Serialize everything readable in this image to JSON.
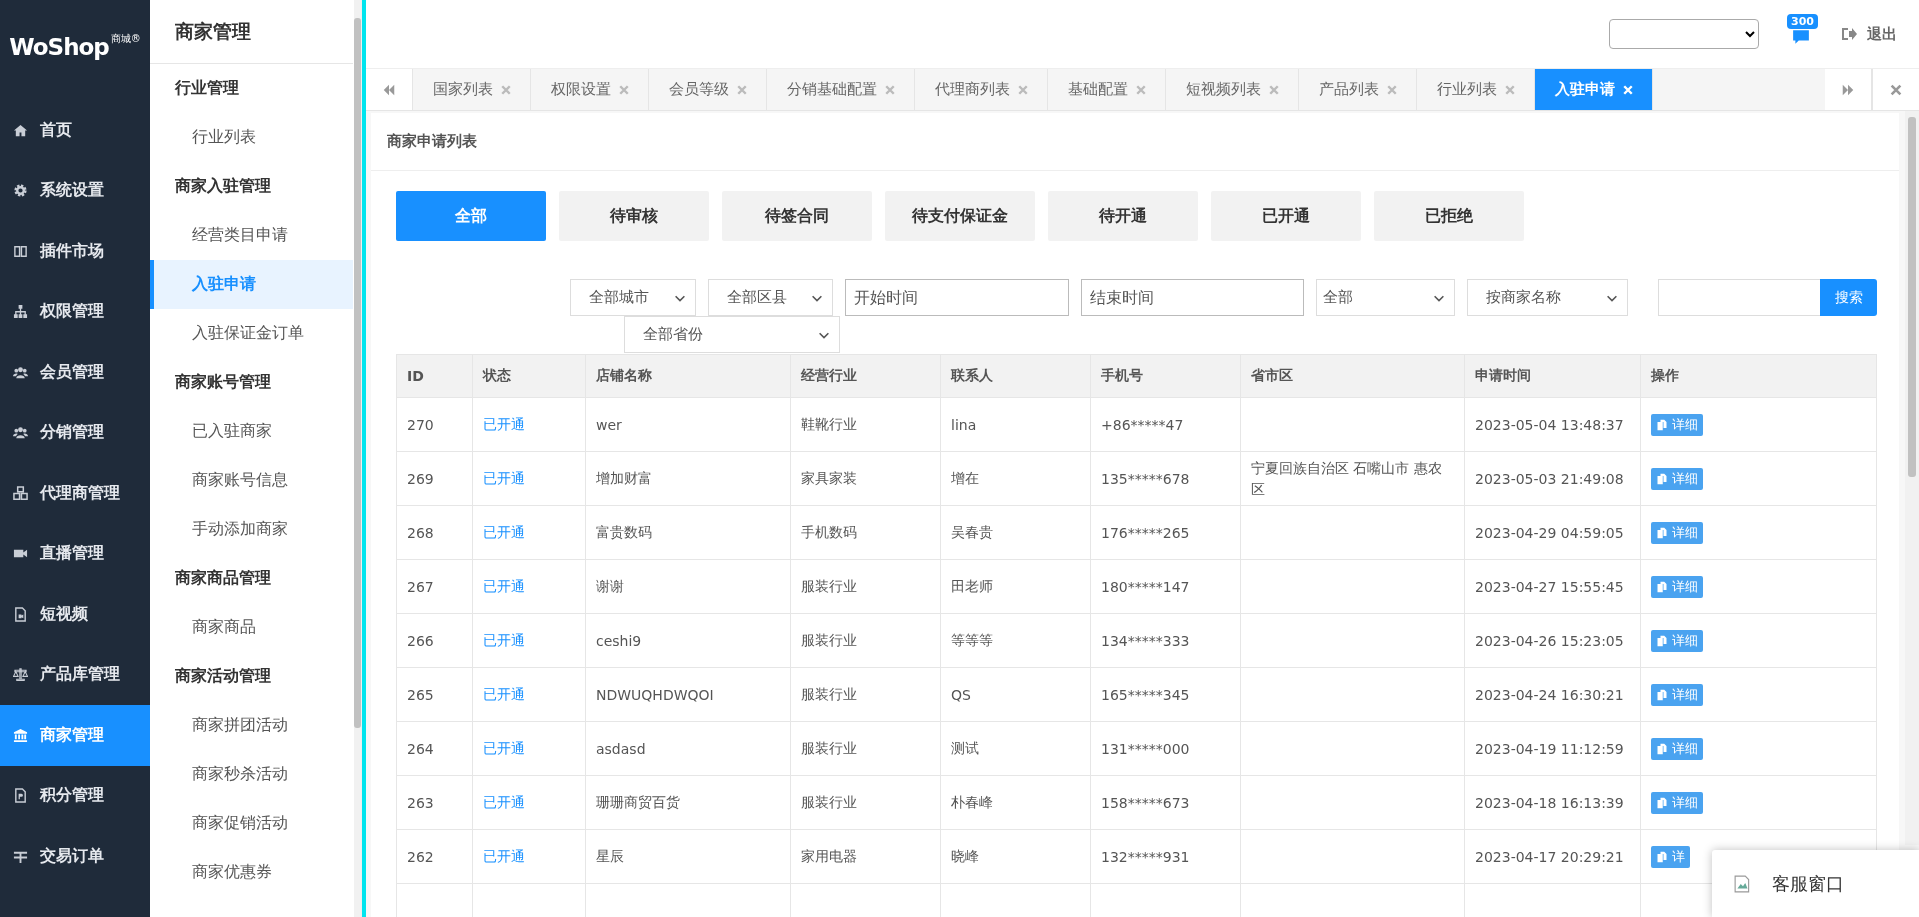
{
  "logo": {
    "name": "WoShop",
    "tag": "商城®"
  },
  "nav": [
    {
      "label": "首页",
      "selected": false
    },
    {
      "label": "系统设置",
      "selected": false
    },
    {
      "label": "插件市场",
      "selected": false
    },
    {
      "label": "权限管理",
      "selected": false
    },
    {
      "label": "会员管理",
      "selected": false
    },
    {
      "label": "分销管理",
      "selected": false
    },
    {
      "label": "代理商管理",
      "selected": false
    },
    {
      "label": "直播管理",
      "selected": false
    },
    {
      "label": "短视频",
      "selected": false
    },
    {
      "label": "产品库管理",
      "selected": false
    },
    {
      "label": "商家管理",
      "selected": true
    },
    {
      "label": "积分管理",
      "selected": false
    },
    {
      "label": "交易订单",
      "selected": false
    }
  ],
  "subnav": {
    "title": "商家管理",
    "groups": [
      {
        "title": "行业管理",
        "items": [
          {
            "label": "行业列表",
            "selected": false
          }
        ]
      },
      {
        "title": "商家入驻管理",
        "items": [
          {
            "label": "经营类目申请",
            "selected": false
          },
          {
            "label": "入驻申请",
            "selected": true
          },
          {
            "label": "入驻保证金订单",
            "selected": false
          }
        ]
      },
      {
        "title": "商家账号管理",
        "items": [
          {
            "label": "已入驻商家",
            "selected": false
          },
          {
            "label": "商家账号信息",
            "selected": false
          },
          {
            "label": "手动添加商家",
            "selected": false
          }
        ]
      },
      {
        "title": "商家商品管理",
        "items": [
          {
            "label": "商家商品",
            "selected": false
          }
        ]
      },
      {
        "title": "商家活动管理",
        "items": [
          {
            "label": "商家拼团活动",
            "selected": false
          },
          {
            "label": "商家秒杀活动",
            "selected": false
          },
          {
            "label": "商家促销活动",
            "selected": false
          },
          {
            "label": "商家优惠券",
            "selected": false
          }
        ]
      }
    ]
  },
  "header": {
    "badge": "300",
    "logout": "退出"
  },
  "tabs": [
    {
      "label": "国家列表",
      "selected": false
    },
    {
      "label": "权限设置",
      "selected": false
    },
    {
      "label": "会员等级",
      "selected": false
    },
    {
      "label": "分销基础配置",
      "selected": false
    },
    {
      "label": "代理商列表",
      "selected": false
    },
    {
      "label": "基础配置",
      "selected": false
    },
    {
      "label": "短视频列表",
      "selected": false
    },
    {
      "label": "产品列表",
      "selected": false
    },
    {
      "label": "行业列表",
      "selected": false
    },
    {
      "label": "入驻申请",
      "selected": true
    }
  ],
  "panel_title": "商家申请列表",
  "status_filters": [
    {
      "label": "全部",
      "selected": true
    },
    {
      "label": "待审核",
      "selected": false
    },
    {
      "label": "待签合同",
      "selected": false
    },
    {
      "label": "待支付保证金",
      "selected": false
    },
    {
      "label": "待开通",
      "selected": false
    },
    {
      "label": "已开通",
      "selected": false
    },
    {
      "label": "已拒绝",
      "selected": false
    }
  ],
  "filters": [
    {
      "kind": "select",
      "value": "全部城市"
    },
    {
      "kind": "select",
      "value": "全部区县"
    },
    {
      "kind": "input",
      "placeholder": "开始时间"
    },
    {
      "kind": "input",
      "placeholder": "结束时间"
    },
    {
      "kind": "select",
      "value": "全部"
    },
    {
      "kind": "select",
      "value": "按商家名称"
    },
    {
      "kind": "search",
      "button": "搜索"
    }
  ],
  "province_filter": "全部省份",
  "table": {
    "columns": [
      "ID",
      "状态",
      "店铺名称",
      "经营行业",
      "联系人",
      "手机号",
      "省市区",
      "申请时间",
      "操作"
    ],
    "rows": [
      {
        "id": "270",
        "status": "已开通",
        "shop": "wer",
        "industry": "鞋靴行业",
        "contact": "lina",
        "phone": "+86*****47",
        "region": "",
        "time": "2023-05-04 13:48:37",
        "action": "详细"
      },
      {
        "id": "269",
        "status": "已开通",
        "shop": "增加财富",
        "industry": "家具家装",
        "contact": "增在",
        "phone": "135*****678",
        "region": "宁夏回族自治区 石嘴山市 惠农区",
        "time": "2023-05-03 21:49:08",
        "action": "详细"
      },
      {
        "id": "268",
        "status": "已开通",
        "shop": "富贵数码",
        "industry": "手机数码",
        "contact": "吴春贵",
        "phone": "176*****265",
        "region": "",
        "time": "2023-04-29 04:59:05",
        "action": "详细"
      },
      {
        "id": "267",
        "status": "已开通",
        "shop": "谢谢",
        "industry": "服装行业",
        "contact": "田老师",
        "phone": "180*****147",
        "region": "",
        "time": "2023-04-27 15:55:45",
        "action": "详细"
      },
      {
        "id": "266",
        "status": "已开通",
        "shop": "ceshi9",
        "industry": "服装行业",
        "contact": "等等等",
        "phone": "134*****333",
        "region": "",
        "time": "2023-04-26 15:23:05",
        "action": "详细"
      },
      {
        "id": "265",
        "status": "已开通",
        "shop": "NDWUQHDWQOI",
        "industry": "服装行业",
        "contact": "QS",
        "phone": "165*****345",
        "region": "",
        "time": "2023-04-24 16:30:21",
        "action": "详细"
      },
      {
        "id": "264",
        "status": "已开通",
        "shop": "asdasd",
        "industry": "服装行业",
        "contact": "测试",
        "phone": "131*****000",
        "region": "",
        "time": "2023-04-19 11:12:59",
        "action": "详细"
      },
      {
        "id": "263",
        "status": "已开通",
        "shop": "珊珊商贸百货",
        "industry": "服装行业",
        "contact": "朴春峰",
        "phone": "158*****673",
        "region": "",
        "time": "2023-04-18 16:13:39",
        "action": "详细"
      },
      {
        "id": "262",
        "status": "已开通",
        "shop": "星辰",
        "industry": "家用电器",
        "contact": "晓峰",
        "phone": "132*****931",
        "region": "",
        "time": "2023-04-17 20:29:21",
        "action": "详"
      }
    ]
  },
  "service_widget": "客服窗口"
}
